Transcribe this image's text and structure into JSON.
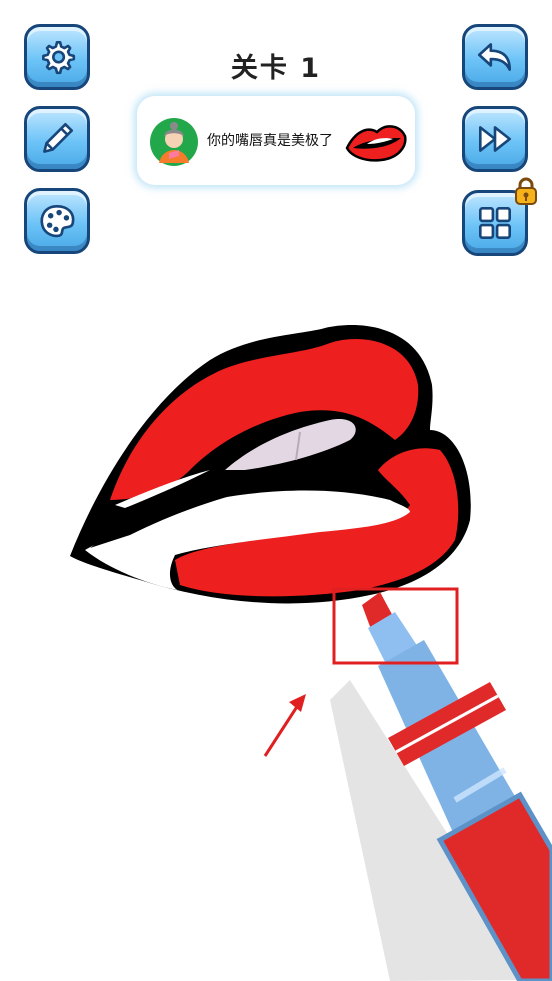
{
  "level": {
    "title": "关卡 1"
  },
  "task": {
    "avatar": "grandma-avatar-icon",
    "text": "你的嘴唇真是美极了",
    "target_icon": "red-lips-icon"
  },
  "left_buttons": [
    {
      "name": "settings-button",
      "icon": "gear-icon"
    },
    {
      "name": "pencil-button",
      "icon": "pencil-icon"
    },
    {
      "name": "palette-button",
      "icon": "palette-icon"
    }
  ],
  "right_buttons": [
    {
      "name": "undo-button",
      "icon": "undo-arrow-icon"
    },
    {
      "name": "skip-button",
      "icon": "fast-forward-icon"
    },
    {
      "name": "levels-grid-button",
      "icon": "grid-icon",
      "locked": true
    }
  ],
  "colors": {
    "lip_red": "#ee1f1f",
    "outline": "#000000",
    "button_border": "#17467a",
    "marker_body": "#7fb3e6",
    "hint_box": "#e02020"
  }
}
